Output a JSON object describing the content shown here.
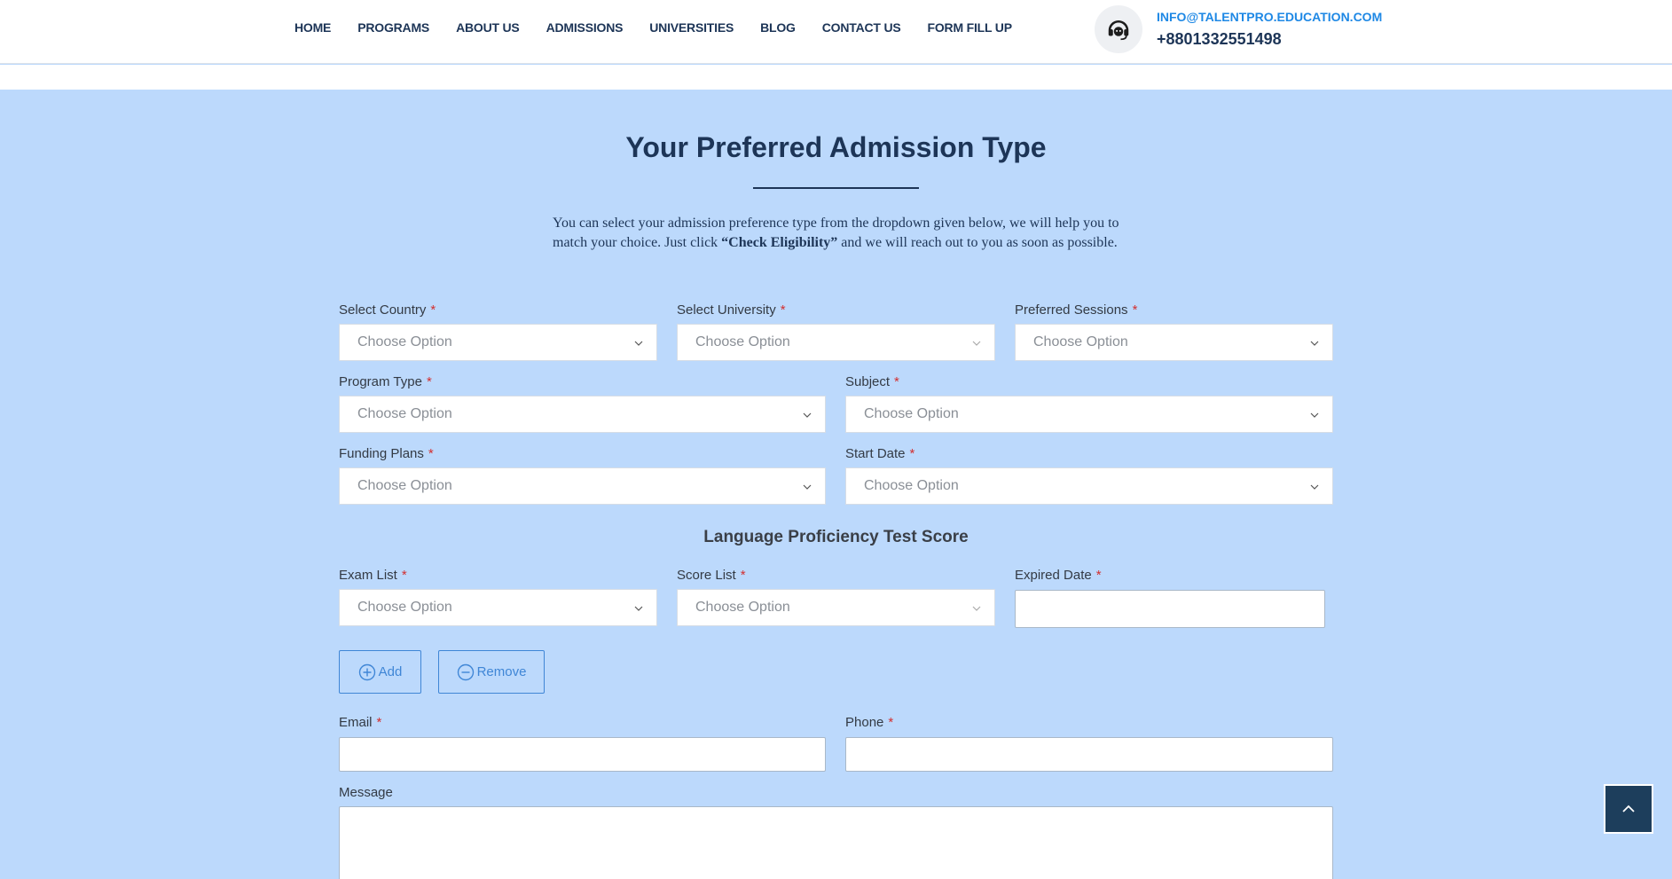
{
  "nav": {
    "items": [
      "HOME",
      "PROGRAMS",
      "ABOUT US",
      "ADMISSIONS",
      "UNIVERSITIES",
      "BLOG",
      "CONTACT US",
      "FORM FILL UP"
    ]
  },
  "contact": {
    "icon": "headset-icon",
    "email": "INFO@TALENTPRO.EDUCATION.COM",
    "phone": "+8801332551498"
  },
  "section": {
    "title": "Your Preferred Admission Type",
    "intro_before": "You can select your admission preference type from the dropdown given below, we will help you to match your choice. Just click ",
    "intro_bold": "“Check Eligibility”",
    "intro_after": " and we will reach out to you as soon as possible."
  },
  "form": {
    "required_mark": "*",
    "placeholder": "Choose Option",
    "country_label": "Select Country",
    "university_label": "Select University",
    "sessions_label": "Preferred Sessions",
    "program_type_label": "Program Type",
    "subject_label": "Subject",
    "funding_label": "Funding Plans",
    "start_date_label": "Start Date",
    "language_heading": "Language Proficiency Test Score",
    "exam_label": "Exam List",
    "score_label": "Score List",
    "expired_label": "Expired Date",
    "add_label": "Add",
    "remove_label": "Remove",
    "email_label": "Email",
    "phone_label": "Phone",
    "message_label": "Message"
  },
  "colors": {
    "background": "#bcd9fc",
    "navy": "#1d3557",
    "accent": "#1e88e5",
    "required": "#d32f2f"
  }
}
